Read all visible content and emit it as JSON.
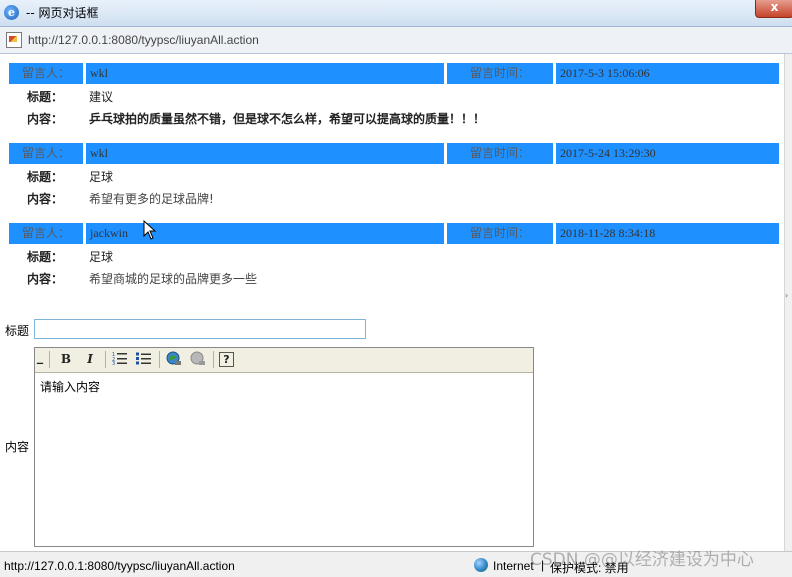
{
  "window": {
    "title": "-- 网页对话框",
    "close_label": "x",
    "address": "http://127.0.0.1:8080/tyypsc/liuyanAll.action"
  },
  "labels": {
    "author": "留言人：",
    "time": "留言时间：",
    "subject": "标题：",
    "body": "内容："
  },
  "messages": [
    {
      "author": "wkl",
      "time": "2017-5-3 15:06:06",
      "subject": "建议",
      "content": "乒乓球拍的质量虽然不错，但是球不怎么样，希望可以提高球的质量！！！"
    },
    {
      "author": "wkl",
      "time": "2017-5-24 13:29:30",
      "subject": "足球",
      "content": "希望有更多的足球品牌!"
    },
    {
      "author": "jackwin",
      "time": "2018-11-28 8:34:18",
      "subject": "足球",
      "content": "希望商城的足球的品牌更多一些"
    }
  ],
  "form": {
    "title_label": "标题",
    "content_label": "内容",
    "title_value": "",
    "editor_text": "请输入内容",
    "toolbar": {
      "bold": "B",
      "italic": "I",
      "help": "?"
    }
  },
  "status": {
    "url": "http://127.0.0.1:8080/tyypsc/liuyanAll.action",
    "zone": "Internet",
    "separator": "|",
    "protected_mode": "保护模式: 禁用"
  },
  "watermark": "CSDN @@以经济建设为中心",
  "colors": {
    "header_bar": "#1e90ff",
    "input_border": "#7fb2d8"
  }
}
